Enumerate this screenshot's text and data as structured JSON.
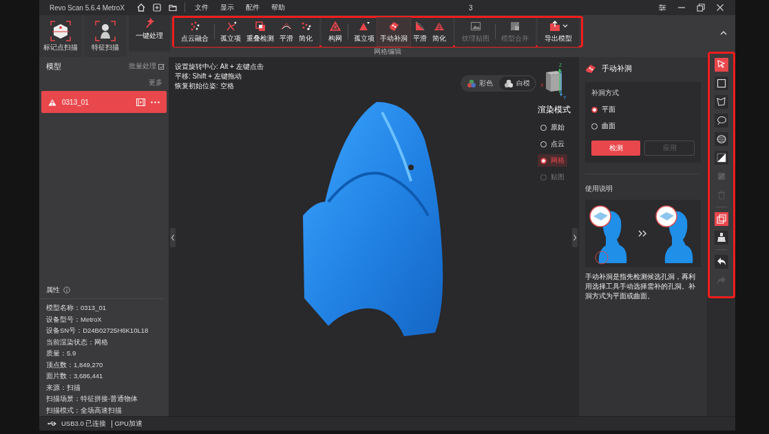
{
  "window": {
    "title": "Revo Scan 5.6.4 MetroX",
    "menus": [
      "文件",
      "显示",
      "配件",
      "帮助"
    ],
    "center_text": "3"
  },
  "toolbar": {
    "scan_modes": [
      {
        "label": "标记点扫描"
      },
      {
        "label": "特征扫描"
      }
    ],
    "groups": [
      {
        "items": [
          {
            "label": "一键处理",
            "disabled": false,
            "selected": false
          }
        ]
      },
      {
        "items": [
          {
            "label": "点云融合",
            "disabled": false,
            "selected": false
          },
          {
            "label": "孤立项",
            "disabled": false,
            "selected": false,
            "divider_before": true
          },
          {
            "label": "重叠检测",
            "disabled": false,
            "selected": false
          },
          {
            "label": "平滑",
            "disabled": false,
            "selected": false
          },
          {
            "label": "简化",
            "disabled": false,
            "selected": false
          }
        ]
      },
      {
        "label": "网格编辑",
        "items": [
          {
            "label": "构网",
            "disabled": false,
            "selected": false
          },
          {
            "label": "孤立项",
            "disabled": false,
            "selected": false,
            "divider_before": true
          },
          {
            "label": "手动补洞",
            "disabled": false,
            "selected": true
          },
          {
            "label": "平滑",
            "disabled": false,
            "selected": false
          },
          {
            "label": "简化",
            "disabled": false,
            "selected": false
          }
        ]
      },
      {
        "items": [
          {
            "label": "纹理贴图",
            "disabled": true,
            "selected": false
          },
          {
            "label": "模型合并",
            "disabled": true,
            "selected": false,
            "divider_before": true
          }
        ]
      },
      {
        "items": [
          {
            "label": "导出模型",
            "disabled": false,
            "selected": false,
            "dropdown": true
          }
        ]
      }
    ]
  },
  "models_panel": {
    "title": "模型",
    "batch": "批量处理",
    "more": "更多",
    "models": [
      {
        "name": "0313_01",
        "selected": true
      }
    ],
    "properties_title": "属性",
    "properties": [
      "模型名称：0313_01",
      "设备型号：MetroX",
      "设备SN号：D24B02725H6K10L18",
      "当前渲染状态：网格",
      "质量：5.9",
      "顶点数：1,849,270",
      "面片数：3,686,441",
      "来源：扫描",
      "扫描场景：特征拼接-普通物体",
      "扫描模式：全场高速扫描"
    ]
  },
  "viewport": {
    "hints": [
      "设置旋转中心: Alt + 左键点击",
      "平移: Shift + 左键拖动",
      "恢复初始位姿: 空格"
    ],
    "color_modes": [
      {
        "label": "彩色",
        "selected": false
      },
      {
        "label": "白模",
        "selected": true
      }
    ],
    "cube_axes": [
      "Z",
      "X",
      "Y"
    ],
    "render_title": "渲染模式",
    "render_modes": [
      {
        "label": "原始",
        "selected": false,
        "disabled": false
      },
      {
        "label": "点云",
        "selected": false,
        "disabled": false
      },
      {
        "label": "网格",
        "selected": true,
        "disabled": false
      },
      {
        "label": "贴图",
        "selected": false,
        "disabled": true
      }
    ]
  },
  "tool_panel": {
    "title": "手动补洞",
    "method_title": "补洞方式",
    "methods": [
      {
        "label": "平面",
        "selected": true
      },
      {
        "label": "曲面",
        "selected": false
      }
    ],
    "buttons": [
      {
        "label": "检测",
        "disabled": false
      },
      {
        "label": "应用",
        "disabled": true
      }
    ],
    "help_title": "使用说明",
    "help_text": "手动补洞是指先检测候选孔洞，再利用选择工具手动选择需补的孔洞。补洞方式为平面或曲面。"
  },
  "side_tools": [
    {
      "selected": true,
      "disabled": false
    },
    {
      "selected": false,
      "disabled": false
    },
    {
      "selected": false,
      "disabled": false
    },
    {
      "selected": false,
      "disabled": false
    },
    {
      "selected": false,
      "disabled": false
    },
    {
      "selected": false,
      "disabled": false
    },
    {
      "selected": false,
      "disabled": true
    },
    {
      "selected": false,
      "disabled": true
    },
    {
      "selected": true,
      "disabled": false,
      "divider_before": true
    },
    {
      "selected": false,
      "disabled": false
    },
    {
      "selected": false,
      "disabled": false,
      "divider_before": true
    },
    {
      "selected": false,
      "disabled": true
    }
  ],
  "status_bar": {
    "connection": "USB3.0 已连接",
    "gpu": "GPU加速"
  }
}
